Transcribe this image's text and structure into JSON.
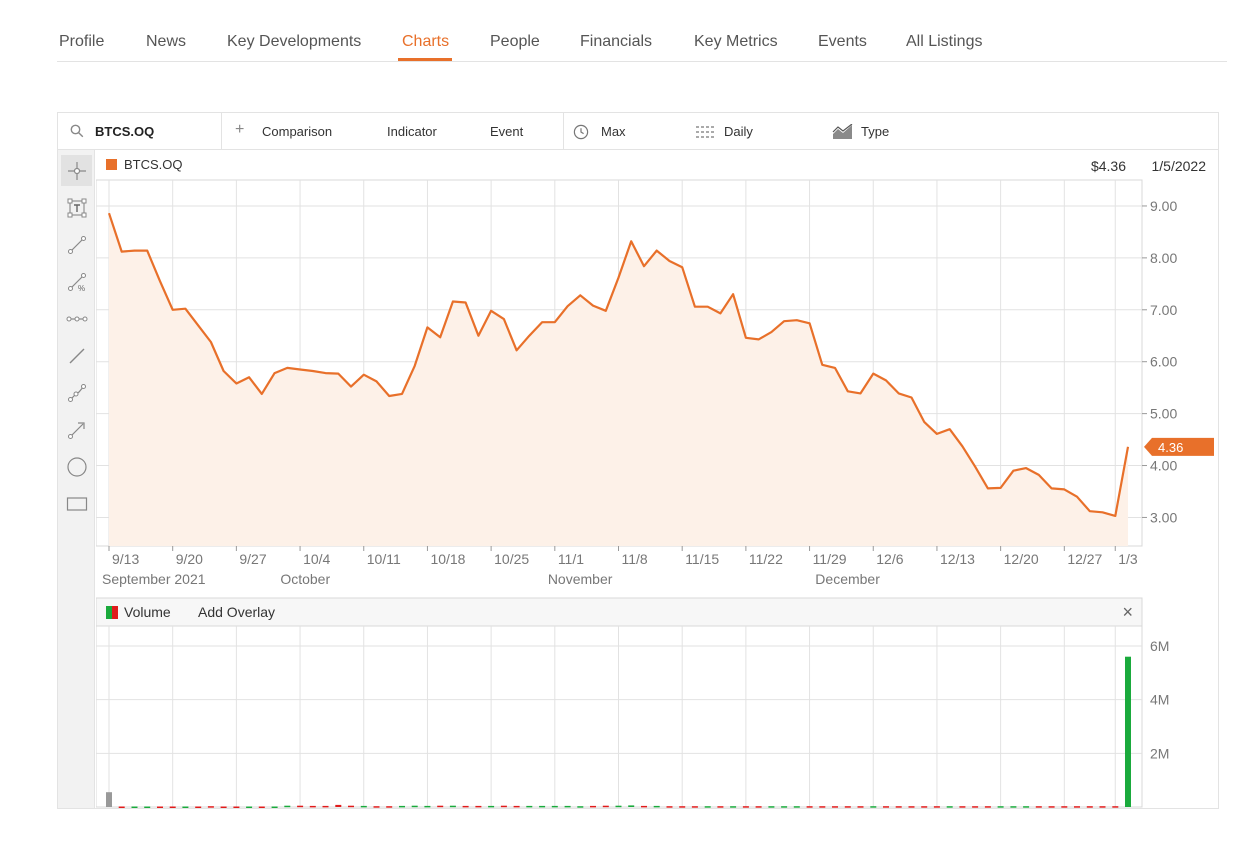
{
  "nav": {
    "tabs": [
      {
        "label": "Profile"
      },
      {
        "label": "News"
      },
      {
        "label": "Key Developments"
      },
      {
        "label": "Charts",
        "active": true
      },
      {
        "label": "People"
      },
      {
        "label": "Financials"
      },
      {
        "label": "Key Metrics"
      },
      {
        "label": "Events"
      },
      {
        "label": "All Listings"
      }
    ]
  },
  "toolbar": {
    "symbol": "BTCS.OQ",
    "comparison": "Comparison",
    "indicator": "Indicator",
    "event": "Event",
    "range": "Max",
    "interval": "Daily",
    "type": "Type"
  },
  "tools": [
    "crosshair-icon",
    "text-annotation-icon",
    "line-segment-icon",
    "percent-line-icon",
    "horizontal-segment-icon",
    "ray-line-icon",
    "multi-point-line-icon",
    "arrow-line-icon",
    "circle-shape-icon",
    "rectangle-shape-icon"
  ],
  "legend": {
    "symbol": "BTCS.OQ",
    "last_price": "$4.36",
    "last_date": "1/5/2022",
    "price_tag": "4.36"
  },
  "volume_panel": {
    "label": "Volume",
    "add_overlay": "Add Overlay",
    "close": "×"
  },
  "colors": {
    "accent": "#e8702a",
    "area_fill": "#fdf1e8",
    "volume_up": "#1aaa3c",
    "volume_down": "#e01b1b",
    "volume_neutral": "#999999"
  },
  "chart_data": [
    {
      "type": "area",
      "series": [
        {
          "name": "BTCS.OQ",
          "values": [
            8.86,
            8.12,
            8.14,
            8.14,
            7.55,
            7.0,
            7.02,
            6.7,
            6.38,
            5.82,
            5.58,
            5.7,
            5.38,
            5.78,
            5.88,
            5.85,
            5.82,
            5.78,
            5.77,
            5.52,
            5.75,
            5.62,
            5.34,
            5.38,
            5.92,
            6.66,
            6.47,
            7.16,
            7.14,
            6.5,
            6.98,
            6.82,
            6.22,
            6.5,
            6.76,
            6.76,
            7.07,
            7.28,
            7.08,
            6.98,
            7.62,
            8.32,
            7.84,
            8.14,
            7.94,
            7.82,
            7.06,
            7.06,
            6.93,
            7.3,
            6.46,
            6.43,
            6.57,
            6.78,
            6.8,
            6.74,
            5.94,
            5.88,
            5.43,
            5.39,
            5.77,
            5.64,
            5.39,
            5.31,
            4.84,
            4.61,
            4.7,
            4.37,
            3.98,
            3.56,
            3.57,
            3.9,
            3.95,
            3.82,
            3.56,
            3.54,
            3.4,
            3.12,
            3.1,
            3.03,
            4.36
          ]
        }
      ],
      "x_ticks": [
        "9/13",
        "9/20",
        "9/27",
        "10/4",
        "10/11",
        "10/18",
        "10/25",
        "11/1",
        "11/8",
        "11/15",
        "11/22",
        "11/29",
        "12/6",
        "12/13",
        "12/20",
        "12/27",
        "1/3"
      ],
      "x_tick_index": [
        0,
        5,
        10,
        15,
        20,
        25,
        30,
        35,
        40,
        45,
        50,
        55,
        60,
        65,
        70,
        75,
        79
      ],
      "x_period_labels": [
        {
          "label": "September 2021",
          "at": 0
        },
        {
          "label": "October",
          "at": 14
        },
        {
          "label": "November",
          "at": 35
        },
        {
          "label": "December",
          "at": 56
        }
      ],
      "y_ticks": [
        "3.00",
        "4.00",
        "5.00",
        "6.00",
        "7.00",
        "8.00",
        "9.00"
      ],
      "ylim": [
        2.45,
        9.5
      ],
      "grid": true
    },
    {
      "type": "bar",
      "series": [
        {
          "name": "Volume",
          "values": [
            0.55,
            0.02,
            0.02,
            0.02,
            0.02,
            0.02,
            0.02,
            0.02,
            0.03,
            0.02,
            0.02,
            0.02,
            0.02,
            0.02,
            0.05,
            0.05,
            0.04,
            0.04,
            0.08,
            0.05,
            0.04,
            0.03,
            0.03,
            0.04,
            0.05,
            0.04,
            0.05,
            0.05,
            0.04,
            0.04,
            0.04,
            0.05,
            0.04,
            0.04,
            0.04,
            0.04,
            0.04,
            0.03,
            0.04,
            0.05,
            0.05,
            0.06,
            0.04,
            0.04,
            0.03,
            0.03,
            0.03,
            0.03,
            0.03,
            0.03,
            0.03,
            0.03,
            0.03,
            0.03,
            0.03,
            0.03,
            0.03,
            0.03,
            0.03,
            0.03,
            0.03,
            0.03,
            0.03,
            0.03,
            0.03,
            0.03,
            0.03,
            0.03,
            0.03,
            0.03,
            0.03,
            0.03,
            0.03,
            0.03,
            0.03,
            0.03,
            0.03,
            0.03,
            0.03,
            0.03,
            5.6
          ]
        }
      ],
      "y_ticks": [
        "2M",
        "4M",
        "6M"
      ],
      "unit": "M",
      "ylim": [
        0,
        6
      ]
    }
  ]
}
